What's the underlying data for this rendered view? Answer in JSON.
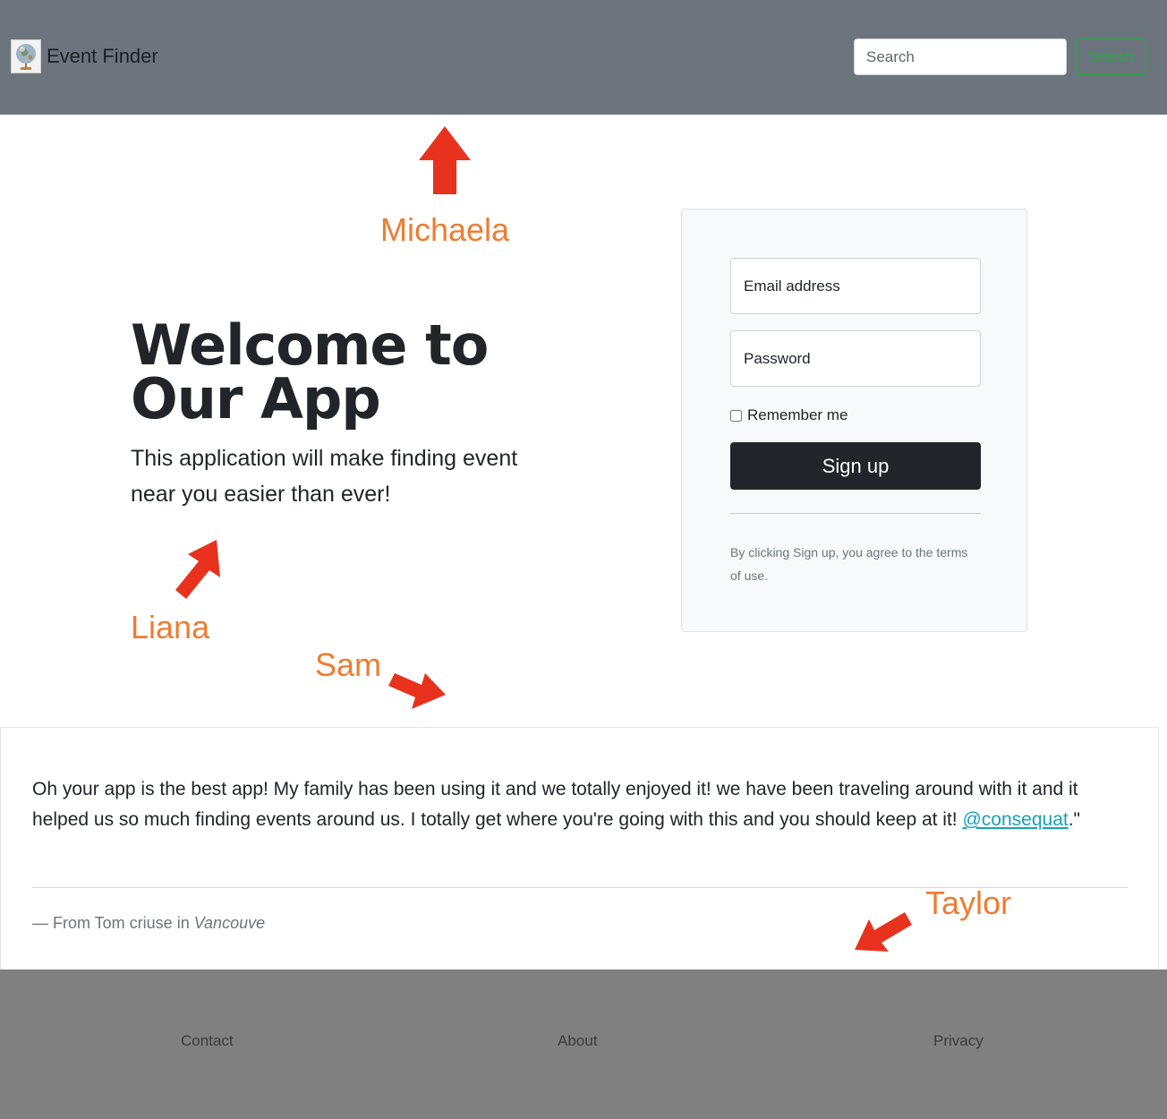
{
  "navbar": {
    "brand_text": "Event Finder",
    "logo_icon": "globe-icon",
    "search_placeholder": "Search",
    "search_button_label": "Search"
  },
  "hero": {
    "title": "Welcome to Our App",
    "subtitle": "This application will make finding event near you easier than ever!"
  },
  "signup": {
    "email_placeholder": "Email address",
    "password_placeholder": "Password",
    "remember_label": "Remember me",
    "remember_checked": false,
    "button_label": "Sign up",
    "terms_text": "By clicking Sign up, you agree to the terms of use."
  },
  "testimonial": {
    "quote_text": "Oh your app is the best app! My family has been using it and we totally enjoyed it! we have been traveling around with it and it helped us so much finding events around us. I totally get where you're going with this and you should keep at it! ",
    "mention": "@consequat",
    "quote_end": ".\"",
    "footer_prefix": "— From Tom criuse in ",
    "footer_place": "Vancouve"
  },
  "footer": {
    "links": [
      "Contact",
      "About",
      "Privacy"
    ]
  },
  "annotations": {
    "labels": [
      "Michaela",
      "Liana",
      "Sam",
      "Taylor"
    ],
    "color": "#ed7d31",
    "arrow_color": "#e8321e"
  },
  "colors": {
    "navbar_bg": "#6c757d",
    "footer_bg": "#808080",
    "primary_dark": "#212529",
    "search_button": "#28a745",
    "link": "#17a2b8"
  }
}
